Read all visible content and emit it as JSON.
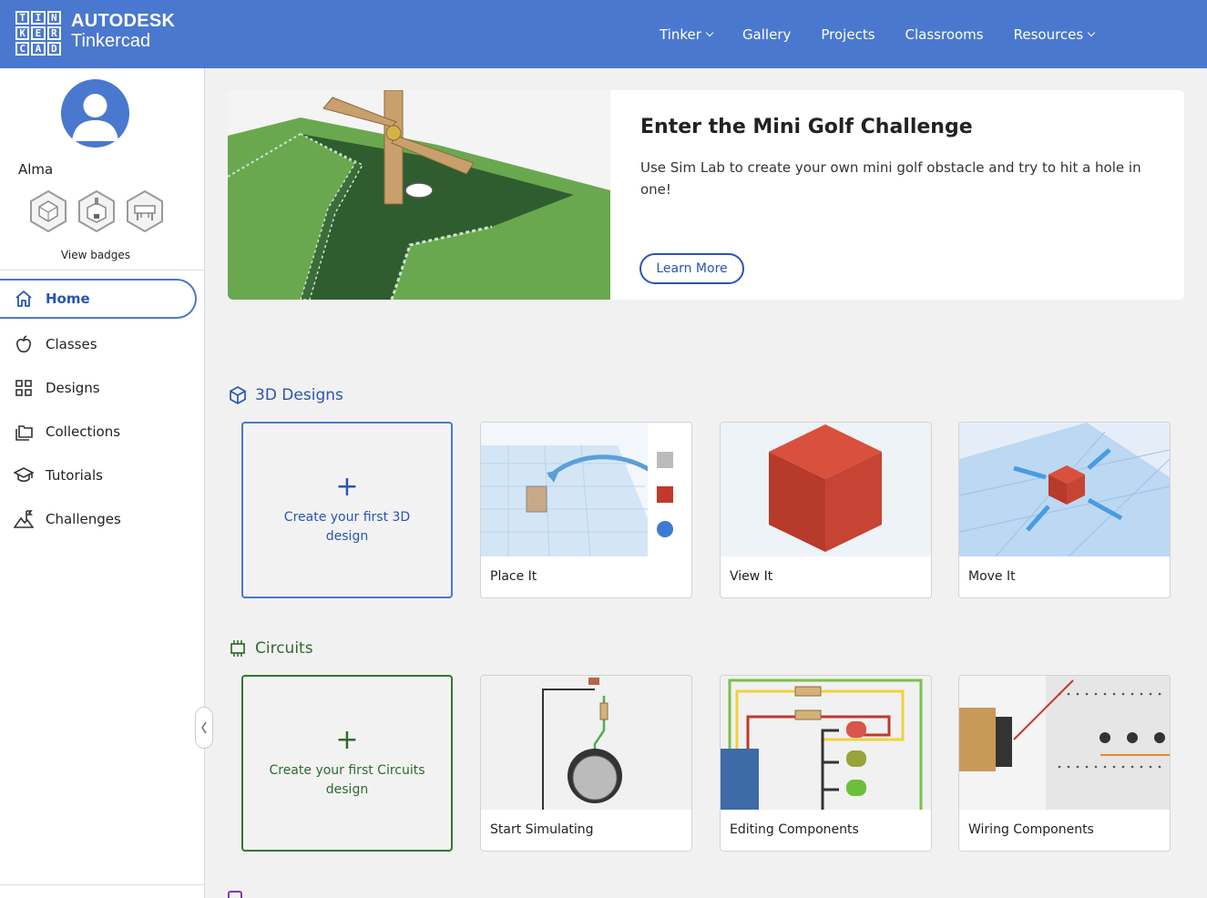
{
  "header": {
    "logo_letters": [
      "T",
      "I",
      "N",
      "K",
      "E",
      "R",
      "C",
      "A",
      "D"
    ],
    "brand_top": "AUTODESK",
    "brand_sub": "Tinkercad",
    "nav": [
      {
        "label": "Tinker",
        "dropdown": true
      },
      {
        "label": "Gallery",
        "dropdown": false
      },
      {
        "label": "Projects",
        "dropdown": false
      },
      {
        "label": "Classrooms",
        "dropdown": false
      },
      {
        "label": "Resources",
        "dropdown": true
      }
    ],
    "color": "#4a78cf"
  },
  "sidebar": {
    "username": "Alma",
    "view_badges": "View badges",
    "items": [
      {
        "label": "Home",
        "icon": "home-icon",
        "active": true
      },
      {
        "label": "Classes",
        "icon": "apple-icon"
      },
      {
        "label": "Designs",
        "icon": "grid-icon"
      },
      {
        "label": "Collections",
        "icon": "folders-icon"
      },
      {
        "label": "Tutorials",
        "icon": "graduation-cap-icon"
      },
      {
        "label": "Challenges",
        "icon": "mountain-flag-icon"
      }
    ]
  },
  "hero": {
    "title": "Enter the Mini Golf Challenge",
    "description": "Use Sim Lab to create your own mini golf obstacle and try to hit a hole in one!",
    "button": "Learn More"
  },
  "designs": {
    "title": "3D Designs",
    "create": "Create your first 3D design",
    "cards": [
      "Place It",
      "View It",
      "Move It"
    ],
    "color": "#2a55b0"
  },
  "circuits": {
    "title": "Circuits",
    "create": "Create your first Circuits design",
    "cards": [
      "Start Simulating",
      "Editing Components",
      "Wiring Components"
    ],
    "color": "#2f6a2f"
  }
}
